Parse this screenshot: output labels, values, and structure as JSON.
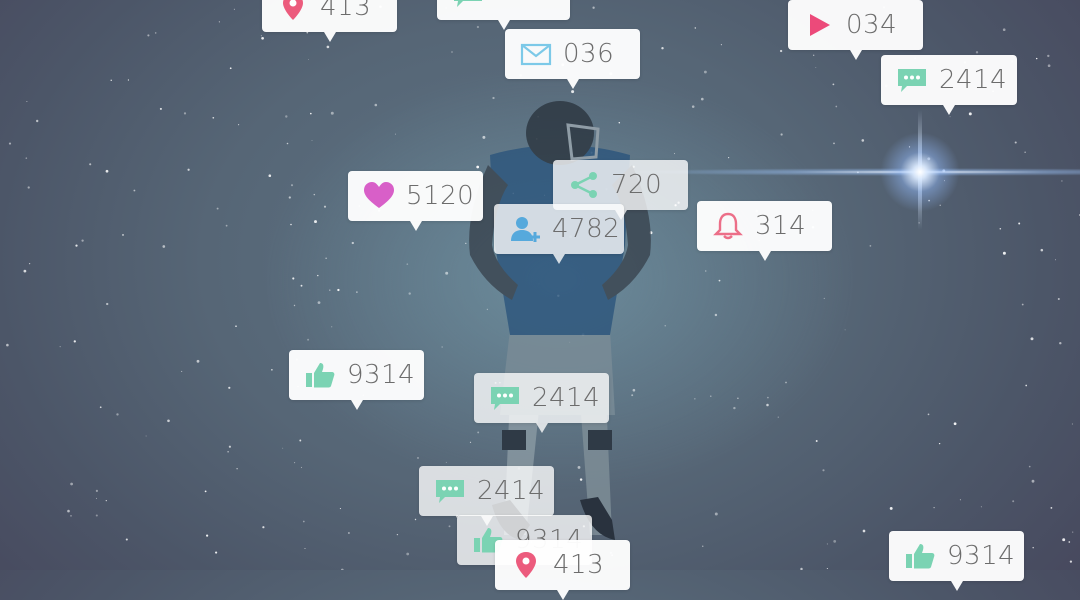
{
  "scene": {
    "subject": "american-football-player",
    "flare_color": "#dbe8ff"
  },
  "colors": {
    "heart": "#d85fc8",
    "pin": "#ec5b7d",
    "play": "#ec4a7a",
    "bell": "#ec6f88",
    "green": "#7bd3b3",
    "blue": "#7cc9e8",
    "person": "#56a9dc"
  },
  "notifications": [
    {
      "icon": "location-pin-icon",
      "value": "413"
    },
    {
      "icon": "speech-bubble-icon",
      "value": ""
    },
    {
      "icon": "play-icon",
      "value": "034"
    },
    {
      "icon": "envelope-icon",
      "value": "036"
    },
    {
      "icon": "chat-icon",
      "value": "2414"
    },
    {
      "icon": "heart-icon",
      "value": "5120"
    },
    {
      "icon": "share-icon",
      "value": "720"
    },
    {
      "icon": "add-user-icon",
      "value": "4782"
    },
    {
      "icon": "bell-icon",
      "value": "314"
    },
    {
      "icon": "thumbs-up-icon",
      "value": "9314"
    },
    {
      "icon": "chat-icon",
      "value": "2414"
    },
    {
      "icon": "chat-icon",
      "value": "2414"
    },
    {
      "icon": "thumbs-up-icon",
      "value": "9314"
    },
    {
      "icon": "location-pin-icon",
      "value": "413"
    },
    {
      "icon": "thumbs-up-icon",
      "value": "9314"
    }
  ]
}
